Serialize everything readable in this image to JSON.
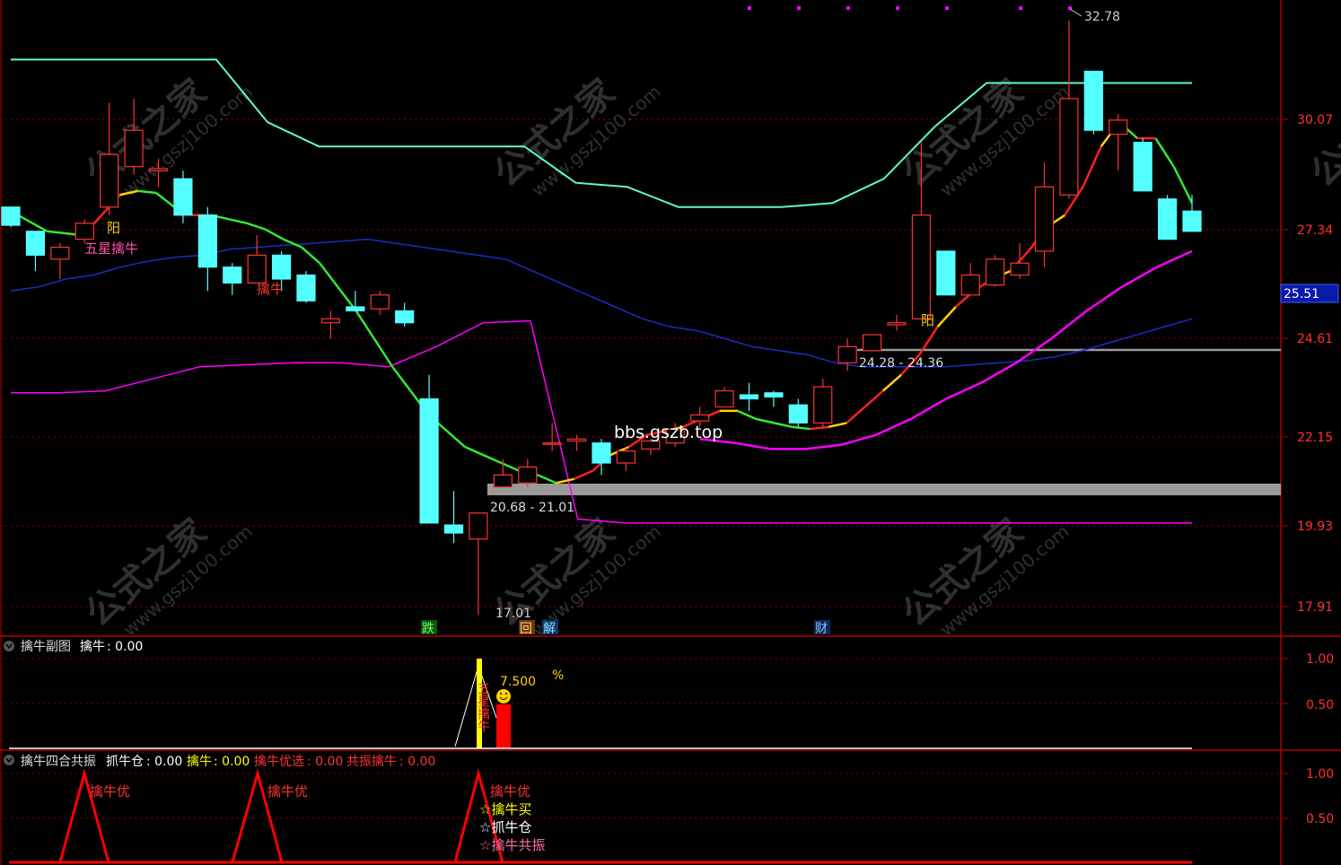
{
  "main_panel": {
    "y_ticks": [
      "30.07",
      "27.34",
      "24.61",
      "22.15",
      "19.93",
      "17.91"
    ],
    "current_price": "25.51",
    "high_label": "32.78",
    "low_label": "17.01",
    "zone_low": "20.68 - 21.01",
    "zone_high": "24.28 - 24.36",
    "watermark_text": "bbs.gszb.top",
    "watermark_cn": "公式之家",
    "watermark_url": "www.gszj100.com",
    "labels": {
      "yang1": "阳",
      "wuxing": "五星擒牛",
      "qinniu": "擒牛",
      "yang2": "阳"
    },
    "bottom_tags": {
      "die": "跌",
      "hui": "回",
      "jie": "解",
      "cai": "财"
    }
  },
  "sub1": {
    "title": "擒牛副图",
    "val_name": "擒牛",
    "val": ": 0.00",
    "y_ticks": [
      "1.00",
      "0.50"
    ],
    "pct_value": "7.500",
    "pct_sign": "%",
    "vert_text": "五星擒牛"
  },
  "sub2": {
    "title": "擒牛四合共振",
    "fields": [
      {
        "name": "抓牛仓",
        "value": ": 0.00"
      },
      {
        "name": "擒牛",
        "value": ": 0.00"
      },
      {
        "name": "擒牛优选",
        "value": ": 0.00"
      },
      {
        "name": "共振擒牛",
        "value": ": 0.00"
      }
    ],
    "y_ticks": [
      "1.00",
      "0.50"
    ],
    "peak_label": "擒牛优",
    "signals": [
      "☆擒牛优",
      "☆擒牛买",
      "☆抓牛仓",
      "☆擒牛共振"
    ]
  },
  "colors": {
    "up": "#ff3232",
    "down": "#54ffff",
    "ma_blue": "#1a2fbf",
    "ma_magenta": "#ff00ff",
    "green": "#33e833",
    "aqua": "#5fffbf",
    "grid": "#8b0000",
    "axis_text": "#ff3232"
  },
  "chart_data": {
    "type": "candlestick",
    "ylim": [
      17.3,
      33.3
    ],
    "y_ticks": [
      30.07,
      27.34,
      24.61,
      22.15,
      19.93,
      17.91
    ],
    "candles": [
      {
        "o": 27.9,
        "c": 27.45,
        "h": 27.9,
        "l": 27.4
      },
      {
        "o": 27.3,
        "c": 26.7,
        "h": 27.3,
        "l": 26.3
      },
      {
        "o": 26.6,
        "c": 26.9,
        "h": 27.0,
        "l": 26.1
      },
      {
        "o": 27.1,
        "c": 27.5,
        "h": 27.6,
        "l": 27.0
      },
      {
        "o": 27.9,
        "c": 29.2,
        "h": 30.5,
        "l": 27.7
      },
      {
        "o": 28.9,
        "c": 29.8,
        "h": 30.6,
        "l": 28.7
      },
      {
        "o": 28.8,
        "c": 28.85,
        "h": 29.1,
        "l": 28.4
      },
      {
        "o": 28.6,
        "c": 27.7,
        "h": 28.8,
        "l": 27.5
      },
      {
        "o": 27.7,
        "c": 26.4,
        "h": 27.9,
        "l": 25.8
      },
      {
        "o": 26.4,
        "c": 26.0,
        "h": 26.5,
        "l": 25.7
      },
      {
        "o": 26.0,
        "c": 26.7,
        "h": 27.2,
        "l": 26.0
      },
      {
        "o": 26.7,
        "c": 26.1,
        "h": 26.8,
        "l": 25.8
      },
      {
        "o": 26.2,
        "c": 25.55,
        "h": 26.3,
        "l": 25.5
      },
      {
        "o": 25.0,
        "c": 25.1,
        "h": 25.3,
        "l": 24.6
      },
      {
        "o": 25.4,
        "c": 25.3,
        "h": 25.8,
        "l": 25.3
      },
      {
        "o": 25.35,
        "c": 25.7,
        "h": 25.8,
        "l": 25.2
      },
      {
        "o": 25.3,
        "c": 25.0,
        "h": 25.5,
        "l": 24.9
      },
      {
        "o": 23.1,
        "c": 20.0,
        "h": 23.7,
        "l": 20.0
      },
      {
        "o": 19.95,
        "c": 19.75,
        "h": 20.8,
        "l": 19.5
      },
      {
        "o": 19.6,
        "c": 20.25,
        "h": 20.25,
        "l": 17.3
      },
      {
        "o": 20.9,
        "c": 21.2,
        "h": 21.6,
        "l": 20.9
      },
      {
        "o": 21.0,
        "c": 21.4,
        "h": 21.6,
        "l": 20.9
      },
      {
        "o": 22.0,
        "c": 22.0,
        "h": 22.5,
        "l": 21.8
      },
      {
        "o": 22.05,
        "c": 22.1,
        "h": 22.2,
        "l": 21.8
      },
      {
        "o": 22.0,
        "c": 21.5,
        "h": 22.1,
        "l": 21.2
      },
      {
        "o": 21.5,
        "c": 21.8,
        "h": 21.9,
        "l": 21.3
      },
      {
        "o": 21.85,
        "c": 22.05,
        "h": 22.1,
        "l": 21.7
      },
      {
        "o": 22.0,
        "c": 22.35,
        "h": 22.5,
        "l": 21.9
      },
      {
        "o": 22.55,
        "c": 22.7,
        "h": 22.9,
        "l": 22.4
      },
      {
        "o": 22.9,
        "c": 23.3,
        "h": 23.4,
        "l": 22.9
      },
      {
        "o": 23.2,
        "c": 23.1,
        "h": 23.5,
        "l": 22.8
      },
      {
        "o": 23.25,
        "c": 23.15,
        "h": 23.3,
        "l": 22.9
      },
      {
        "o": 22.95,
        "c": 22.5,
        "h": 23.1,
        "l": 22.4
      },
      {
        "o": 22.5,
        "c": 23.4,
        "h": 23.6,
        "l": 22.4
      },
      {
        "o": 24.0,
        "c": 24.4,
        "h": 24.6,
        "l": 23.8
      },
      {
        "o": 24.3,
        "c": 24.7,
        "h": 24.7,
        "l": 24.3
      },
      {
        "o": 24.95,
        "c": 25.0,
        "h": 25.2,
        "l": 24.8
      },
      {
        "o": 25.1,
        "c": 27.7,
        "h": 29.5,
        "l": 25.1
      },
      {
        "o": 26.8,
        "c": 25.7,
        "h": 26.8,
        "l": 25.7
      },
      {
        "o": 25.7,
        "c": 26.2,
        "h": 26.5,
        "l": 25.7
      },
      {
        "o": 25.95,
        "c": 26.6,
        "h": 26.7,
        "l": 25.9
      },
      {
        "o": 26.2,
        "c": 26.5,
        "h": 27.0,
        "l": 26.1
      },
      {
        "o": 26.8,
        "c": 28.4,
        "h": 29.0,
        "l": 26.4
      },
      {
        "o": 28.2,
        "c": 30.6,
        "h": 32.6,
        "l": 28.1
      },
      {
        "o": 31.3,
        "c": 29.8,
        "h": 31.3,
        "l": 29.7
      },
      {
        "o": 29.7,
        "c": 30.05,
        "h": 30.2,
        "l": 28.8
      },
      {
        "o": 29.5,
        "c": 28.3,
        "h": 29.6,
        "l": 28.3
      },
      {
        "o": 28.1,
        "c": 27.1,
        "h": 28.2,
        "l": 27.1
      },
      {
        "o": 27.8,
        "c": 27.3,
        "h": 28.2,
        "l": 27.3
      }
    ],
    "lines": {
      "ma_trend": [
        27.8,
        27.55,
        27.3,
        27.25,
        27.2,
        27.7,
        28.2,
        28.3,
        28.25,
        27.9,
        27.7,
        27.7,
        27.6,
        27.5,
        27.35,
        27.1,
        26.9,
        26.5,
        25.9,
        25.3,
        24.6,
        23.9,
        23.3,
        22.7,
        22.3,
        21.9,
        21.7,
        21.5,
        21.3,
        21.2,
        21.0,
        21.1,
        21.3,
        21.7,
        21.9,
        22.2,
        22.3,
        22.4,
        22.6,
        22.8,
        22.8,
        22.6,
        22.5,
        22.4,
        22.35,
        22.4,
        22.5,
        22.9,
        23.3,
        23.7,
        24.2,
        24.9,
        25.4,
        25.8,
        26.1,
        26.3,
        26.8,
        27.4,
        27.7,
        28.4,
        29.4,
        30.0,
        29.6,
        29.6,
        28.9,
        28.0
      ],
      "sup_line": [
        27.5,
        27.1,
        27.05,
        27.1,
        27.2,
        27.6,
        27.8,
        27.9,
        28.0,
        28.0,
        27.9,
        27.7,
        27.6,
        27.3,
        26.8,
        26.4,
        25.8,
        25.3,
        25.1,
        25.0,
        24.6,
        23.8,
        23.3,
        23.7,
        25.0,
        24.9,
        21.2,
        20.9,
        21.0,
        21.5,
        21.9,
        22.0,
        22.1,
        22.2,
        22.3,
        22.0,
        21.9,
        22.0,
        22.2,
        22.7,
        23.0,
        23.4,
        24.1,
        24.6,
        25.0,
        25.7,
        26.3,
        26.5,
        26.9,
        27.2,
        28.2,
        29.4,
        30.1,
        30.0,
        29.7,
        29.0
      ],
      "ma_blue": [
        25.8,
        25.9,
        26.1,
        26.2,
        26.4,
        26.55,
        26.65,
        26.7,
        26.85,
        26.9,
        26.95,
        27.0,
        27.05,
        27.1,
        27.0,
        26.9,
        26.8,
        26.7,
        26.6,
        26.3,
        26.0,
        25.7,
        25.4,
        25.1,
        24.9,
        24.8,
        24.6,
        24.4,
        24.3,
        24.2,
        24.0,
        23.9,
        23.9,
        23.9,
        23.9,
        23.95,
        24.0,
        24.05,
        24.15,
        24.3,
        24.5,
        24.7,
        24.9,
        25.1
      ],
      "magenta_lower": [
        23.25,
        23.25,
        23.3,
        23.6,
        23.9,
        23.95,
        24.0,
        24.0,
        23.9,
        24.4,
        25.0,
        25.05,
        20.1,
        20.0,
        20.0,
        20.0,
        20.0,
        20.0,
        20.0,
        20.0,
        20.0,
        20.0,
        20.0,
        20.0,
        20.0,
        20.0
      ],
      "magenta_ma": [
        22.1,
        22.0,
        21.85,
        21.85,
        21.95,
        22.2,
        22.6,
        23.1,
        23.5,
        24.0,
        24.6,
        25.3,
        25.9,
        26.4,
        26.8
      ],
      "aqua_upper": [
        31.6,
        31.6,
        31.6,
        31.6,
        31.6,
        30.0,
        29.4,
        29.4,
        29.4,
        29.4,
        29.4,
        28.5,
        28.4,
        27.9,
        27.9,
        27.9,
        28.0,
        28.6,
        29.9,
        31.0,
        31.0,
        31.0,
        31.0,
        31.0
      ]
    },
    "zones": [
      {
        "label": "20.68 - 21.01",
        "low": 20.68,
        "high": 21.01
      },
      {
        "label": "24.28 - 24.36",
        "low": 24.28,
        "high": 24.36
      }
    ],
    "sub1": {
      "ylim": [
        0,
        1.0
      ],
      "bar_value": 7.5,
      "y_ticks": [
        1.0,
        0.5
      ]
    },
    "sub2": {
      "ylim": [
        0,
        1.0
      ],
      "peaks": 3,
      "y_ticks": [
        1.0,
        0.5
      ]
    }
  }
}
